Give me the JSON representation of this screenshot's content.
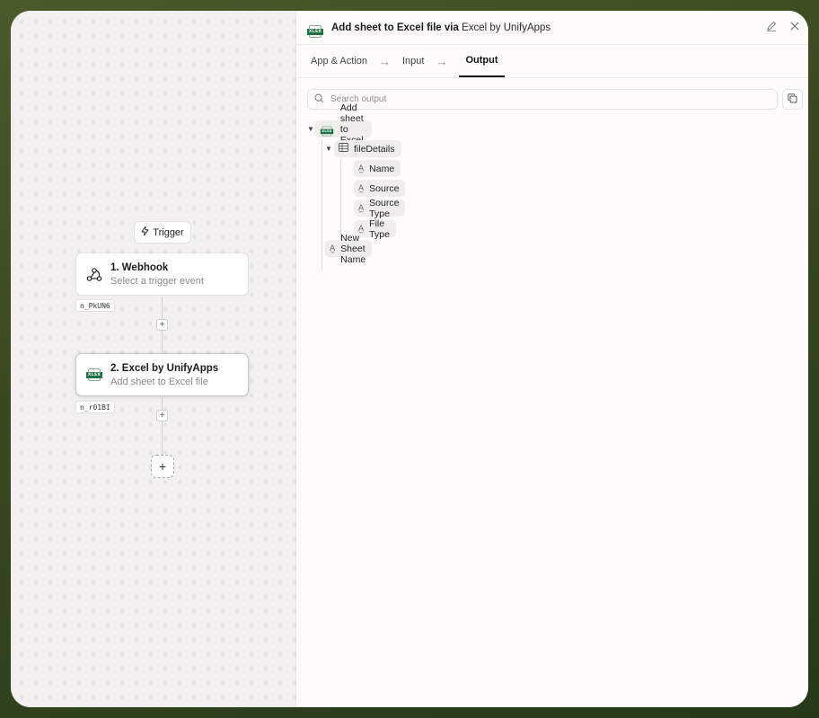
{
  "canvas": {
    "trigger_label": "Trigger",
    "nodes": [
      {
        "title": "1. Webhook",
        "subtitle": "Select a trigger event",
        "id": "n_PkUN6",
        "icon": "webhook-icon"
      },
      {
        "title": "2. Excel by UnifyApps",
        "subtitle": "Add sheet to Excel file",
        "id": "n_r01BI",
        "icon": "xlsx-icon"
      }
    ],
    "plus": "+"
  },
  "panel": {
    "title_action": "Add sheet to Excel file via",
    "title_app": "Excel by UnifyApps",
    "icon_text": "XLSX",
    "tabs": [
      {
        "label": "App & Action"
      },
      {
        "label": "Input"
      },
      {
        "label": "Output",
        "active": true
      }
    ],
    "search_placeholder": "Search output",
    "tree": {
      "root": "Add sheet to Excel file",
      "object": "fileDetails",
      "fields": [
        "Name",
        "Source",
        "Source Type",
        "File Type"
      ],
      "sibling": "New Sheet Name"
    }
  },
  "colors": {
    "excel_green": "#1e7145",
    "frame_bg": "#3a4a20"
  }
}
